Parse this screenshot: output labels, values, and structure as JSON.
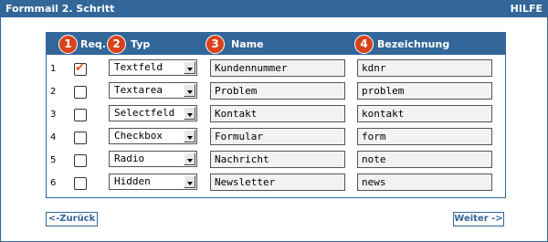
{
  "window": {
    "title": "Formmail 2. Schritt",
    "help": "HILFE"
  },
  "table": {
    "headers": [
      {
        "badge": "1",
        "label": "Req."
      },
      {
        "badge": "2",
        "label": "Typ"
      },
      {
        "badge": "3",
        "label": "Name"
      },
      {
        "badge": "4",
        "label": "Bezeichnung"
      }
    ],
    "rows": [
      {
        "index": "1",
        "required": true,
        "type": "Textfeld",
        "name": "Kundennummer",
        "label": "kdnr"
      },
      {
        "index": "2",
        "required": false,
        "type": "Textarea",
        "name": "Problem",
        "label": "problem"
      },
      {
        "index": "3",
        "required": false,
        "type": "Selectfeld",
        "name": "Kontakt",
        "label": "kontakt"
      },
      {
        "index": "4",
        "required": false,
        "type": "Checkbox",
        "name": "Formular",
        "label": "form"
      },
      {
        "index": "5",
        "required": false,
        "type": "Radio",
        "name": "Nachricht",
        "label": "note"
      },
      {
        "index": "6",
        "required": false,
        "type": "Hidden",
        "name": "Newsletter",
        "label": "news"
      }
    ]
  },
  "nav": {
    "back": "<-Zurück",
    "next": "Weiter ->"
  },
  "colors": {
    "primary": "#336699",
    "badge": "#d9421a",
    "input_bg": "#f2f2f2"
  }
}
